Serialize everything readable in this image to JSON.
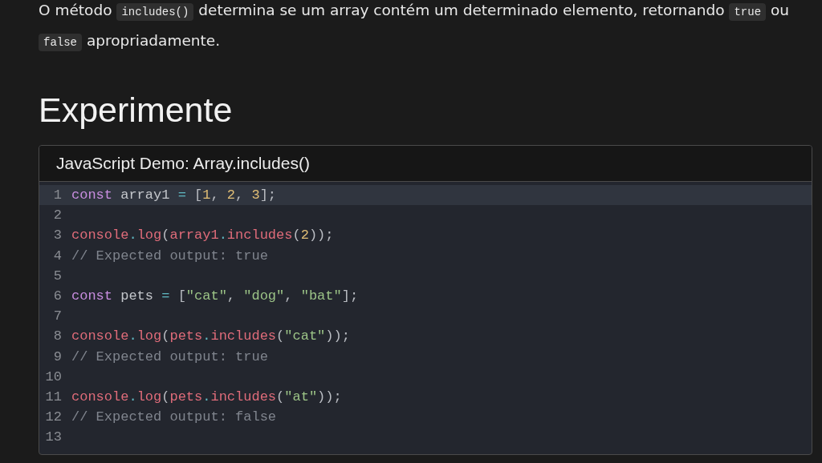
{
  "intro": [
    {
      "kind": "text",
      "text": "O método "
    },
    {
      "kind": "code",
      "text": "includes()"
    },
    {
      "kind": "text",
      "text": " determina se um array contém um determinado elemento, retornando "
    },
    {
      "kind": "code",
      "text": "true"
    },
    {
      "kind": "text",
      "text": " ou "
    },
    {
      "kind": "code",
      "text": "false"
    },
    {
      "kind": "text",
      "text": " apropriadamente."
    }
  ],
  "heading": "Experimente",
  "demo": {
    "title": "JavaScript Demo: Array.includes()",
    "lines": [
      {
        "number": "1",
        "active": true,
        "tokens": [
          {
            "kind": "keyword",
            "text": "const"
          },
          {
            "kind": "plain",
            "text": " array1 "
          },
          {
            "kind": "operator",
            "text": "="
          },
          {
            "kind": "punct",
            "text": " ["
          },
          {
            "kind": "number",
            "text": "1"
          },
          {
            "kind": "punct",
            "text": ", "
          },
          {
            "kind": "number",
            "text": "2"
          },
          {
            "kind": "punct",
            "text": ", "
          },
          {
            "kind": "number",
            "text": "3"
          },
          {
            "kind": "punct",
            "text": "];"
          }
        ]
      },
      {
        "number": "2",
        "active": false
      },
      {
        "number": "3",
        "active": false,
        "tokens": [
          {
            "kind": "call",
            "text": "console"
          },
          {
            "kind": "operator",
            "text": "."
          },
          {
            "kind": "call",
            "text": "log"
          },
          {
            "kind": "punct",
            "text": "("
          },
          {
            "kind": "call",
            "text": "array1"
          },
          {
            "kind": "operator",
            "text": "."
          },
          {
            "kind": "call",
            "text": "includes"
          },
          {
            "kind": "punct",
            "text": "("
          },
          {
            "kind": "number",
            "text": "2"
          },
          {
            "kind": "punct",
            "text": "));"
          }
        ]
      },
      {
        "number": "4",
        "active": false,
        "tokens": [
          {
            "kind": "comment",
            "text": "// Expected output: true"
          }
        ]
      },
      {
        "number": "5",
        "active": false
      },
      {
        "number": "6",
        "active": false,
        "tokens": [
          {
            "kind": "keyword",
            "text": "const"
          },
          {
            "kind": "plain",
            "text": " pets "
          },
          {
            "kind": "operator",
            "text": "="
          },
          {
            "kind": "punct",
            "text": " ["
          },
          {
            "kind": "string",
            "text": "\"cat\""
          },
          {
            "kind": "punct",
            "text": ", "
          },
          {
            "kind": "string",
            "text": "\"dog\""
          },
          {
            "kind": "punct",
            "text": ", "
          },
          {
            "kind": "string",
            "text": "\"bat\""
          },
          {
            "kind": "punct",
            "text": "];"
          }
        ]
      },
      {
        "number": "7",
        "active": false
      },
      {
        "number": "8",
        "active": false,
        "tokens": [
          {
            "kind": "call",
            "text": "console"
          },
          {
            "kind": "operator",
            "text": "."
          },
          {
            "kind": "call",
            "text": "log"
          },
          {
            "kind": "punct",
            "text": "("
          },
          {
            "kind": "call",
            "text": "pets"
          },
          {
            "kind": "operator",
            "text": "."
          },
          {
            "kind": "call",
            "text": "includes"
          },
          {
            "kind": "punct",
            "text": "("
          },
          {
            "kind": "string",
            "text": "\"cat\""
          },
          {
            "kind": "punct",
            "text": "));"
          }
        ]
      },
      {
        "number": "9",
        "active": false,
        "tokens": [
          {
            "kind": "comment",
            "text": "// Expected output: true"
          }
        ]
      },
      {
        "number": "10",
        "active": false
      },
      {
        "number": "11",
        "active": false,
        "tokens": [
          {
            "kind": "call",
            "text": "console"
          },
          {
            "kind": "operator",
            "text": "."
          },
          {
            "kind": "call",
            "text": "log"
          },
          {
            "kind": "punct",
            "text": "("
          },
          {
            "kind": "call",
            "text": "pets"
          },
          {
            "kind": "operator",
            "text": "."
          },
          {
            "kind": "call",
            "text": "includes"
          },
          {
            "kind": "punct",
            "text": "("
          },
          {
            "kind": "string",
            "text": "\"at\""
          },
          {
            "kind": "punct",
            "text": "));"
          }
        ]
      },
      {
        "number": "12",
        "active": false,
        "tokens": [
          {
            "kind": "comment",
            "text": "// Expected output: false"
          }
        ]
      },
      {
        "number": "13",
        "active": false
      }
    ]
  }
}
